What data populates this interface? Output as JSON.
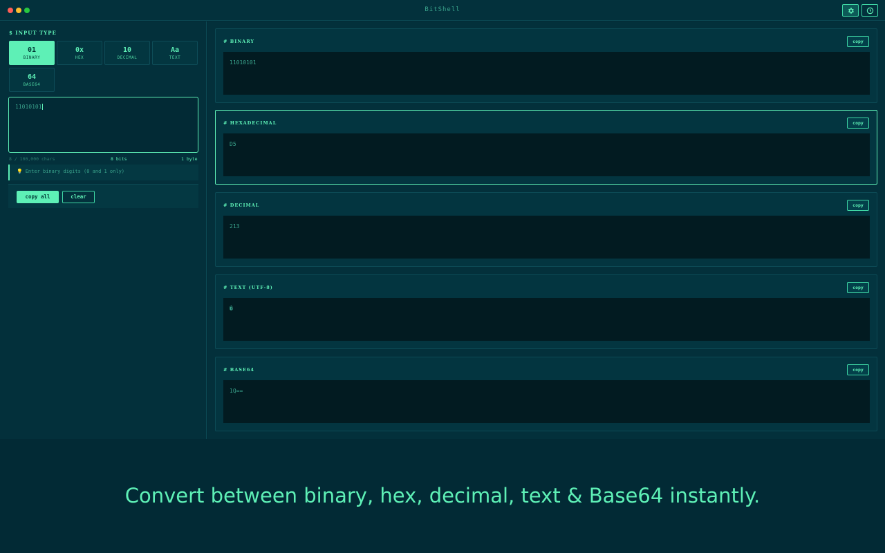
{
  "app": {
    "title": "BitShell"
  },
  "toolbar": {
    "settings_icon": "gear-icon",
    "history_icon": "clock-icon"
  },
  "sidebar": {
    "section_label": "$ INPUT TYPE",
    "types": [
      {
        "symbol": "01",
        "label": "BINARY",
        "active": true
      },
      {
        "symbol": "0x",
        "label": "HEX",
        "active": false
      },
      {
        "symbol": "10",
        "label": "DECIMAL",
        "active": false
      },
      {
        "symbol": "Aa",
        "label": "TEXT",
        "active": false
      },
      {
        "symbol": "64",
        "label": "BASE64",
        "active": false
      }
    ],
    "input_value": "11010101",
    "char_count": "8 / 100,000 chars",
    "bits": "8 bits",
    "bytes": "1 byte",
    "hint": "Enter binary digits (0 and 1 only)",
    "copy_all_label": "copy all",
    "clear_label": "clear"
  },
  "outputs": [
    {
      "title": "# BINARY",
      "value": "11010101",
      "copy_label": "copy",
      "active": false
    },
    {
      "title": "# HEXADECIMAL",
      "value": "D5",
      "copy_label": "copy",
      "active": true
    },
    {
      "title": "# DECIMAL",
      "value": "213",
      "copy_label": "copy",
      "active": false
    },
    {
      "title": "# TEXT (UTF-8)",
      "value": "�",
      "copy_label": "copy",
      "active": false
    },
    {
      "title": "# BASE64",
      "value": "1Q==",
      "copy_label": "copy",
      "active": false
    }
  ],
  "tagline": "Convert between binary, hex, decimal, text & Base64 instantly.",
  "colors": {
    "accent": "#5ef0b6",
    "background": "#022a35",
    "panel": "#03303b"
  }
}
